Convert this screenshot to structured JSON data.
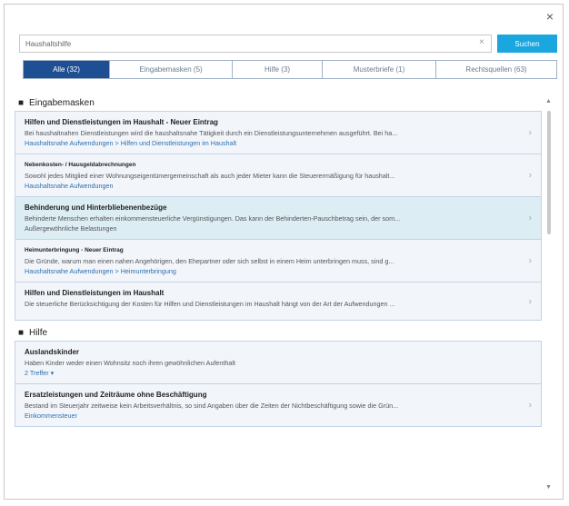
{
  "dialog": {
    "close_glyph": "×"
  },
  "search": {
    "value": "Haushaltshilfe",
    "clear_glyph": "×",
    "button_label": "Suchen"
  },
  "tabs": [
    {
      "label": "Alle (32)",
      "active": true
    },
    {
      "label": "Eingabemasken (5)",
      "active": false
    },
    {
      "label": "Hilfe (3)",
      "active": false
    },
    {
      "label": "Musterbriefe (1)",
      "active": false
    },
    {
      "label": "Rechtsquellen (63)",
      "active": false
    }
  ],
  "sections": [
    {
      "heading": "Eingabemasken",
      "items": [
        {
          "title": "Hilfen und Dienstleistungen im Haushalt - Neuer Eintrag",
          "desc": "Bei haushaltnahen Dienstleistungen wird die haushaltsnahe Tätigkeit durch ein Dienstleistungsunternehmen ausgeführt. Bei ha...",
          "link": "Haushaltsnahe Aufwendungen > Hilfen und Dienstleistungen im Haushalt"
        },
        {
          "title": "Nebenkosten- / Hausgeldabrechnungen",
          "desc": "Sowohl jedes Mitglied einer Wohnungseigentümergemeinschaft als auch jeder Mieter kann die Steuerermäßigung für haushalt...",
          "link": "Haushaltsnahe Aufwendungen"
        },
        {
          "title": "Behinderung und Hinterbliebenenbezüge",
          "desc": "Behinderte Menschen erhalten einkommensteuerliche Vergünstigungen. Das kann der Behinderten-Pauschbetrag sein, der som...",
          "link": "Außergewöhnliche Belastungen"
        },
        {
          "title": "Heimunterbringung - Neuer Eintrag",
          "desc": "Die Gründe, warum man einen nahen Angehörigen, den Ehepartner oder sich selbst in einem Heim unterbringen muss, sind g...",
          "link": "Haushaltsnahe Aufwendungen > Heimunterbringung"
        },
        {
          "title": "Hilfen und Dienstleistungen im Haushalt",
          "desc": "Die steuerliche Berücksichtigung der Kosten für Hilfen und Dienstleistungen im Haushalt hängt von der Art der Aufwendungen ...",
          "link": ""
        }
      ]
    },
    {
      "heading": "Hilfe",
      "items": [
        {
          "title": "Auslandskinder",
          "desc": "Haben Kinder weder einen Wohnsitz noch ihren gewöhnlichen Aufenthalt",
          "link": "2 Treffer ▾"
        },
        {
          "title": "Ersatzleistungen und Zeiträume ohne Beschäftigung",
          "desc": "Bestand im Steuerjahr zeitweise kein Arbeitsverhältnis, so sind Angaben über die Zeiten der Nichtbeschäftigung sowie die Grün...",
          "link": "Einkommensteuer"
        }
      ]
    }
  ],
  "colors": {
    "accent": "#1aa7df",
    "active_tab": "#1e4f93",
    "highlight_row": "#dcedf4",
    "link": "#2f6fb0"
  },
  "icons": {
    "chevron": "›",
    "scroll_up": "▲",
    "scroll_down": "▼",
    "bullet": "■"
  }
}
